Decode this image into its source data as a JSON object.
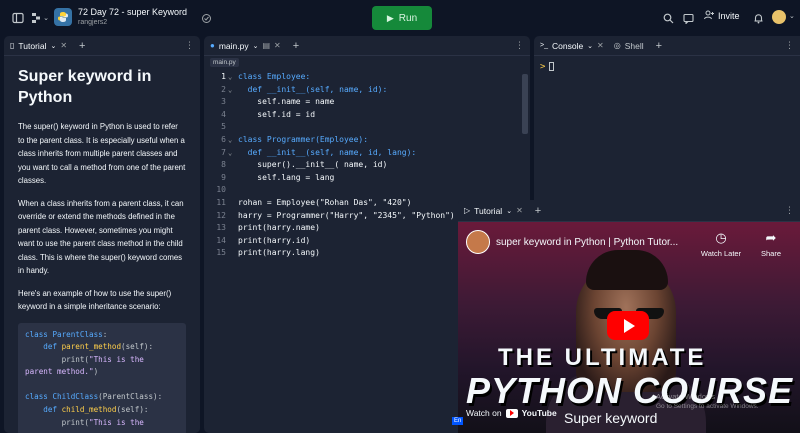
{
  "topbar": {
    "repl_title": "72 Day 72 - super Keyword",
    "repl_user": "rangjers2",
    "run_label": "Run",
    "invite_label": "Invite"
  },
  "tutorial_pane": {
    "tab_label": "Tutorial",
    "title": "Super keyword in Python",
    "paragraphs": [
      "The super() keyword in Python is used to refer to the parent class. It is especially useful when a class inherits from multiple parent classes and you want to call a method from one of the parent classes.",
      "When a class inherits from a parent class, it can override or extend the methods defined in the parent class. However, sometimes you might want to use the parent class method in the child class. This is where the super() keyword comes in handy.",
      "Here's an example of how to use the super() keyword in a simple inheritance scenario:"
    ]
  },
  "editor": {
    "tab_label": "main.py",
    "crumb": "main.py",
    "lines": [
      {
        "n": "1",
        "t": "class Employee:"
      },
      {
        "n": "2",
        "t": "  def __init__(self, name, id):"
      },
      {
        "n": "3",
        "t": "    self.name = name"
      },
      {
        "n": "4",
        "t": "    self.id = id"
      },
      {
        "n": "5",
        "t": ""
      },
      {
        "n": "6",
        "t": "class Programmer(Employee):"
      },
      {
        "n": "7",
        "t": "  def __init__(self, name, id, lang):"
      },
      {
        "n": "8",
        "t": "    super().__init__( name, id)"
      },
      {
        "n": "9",
        "t": "    self.lang = lang"
      },
      {
        "n": "10",
        "t": ""
      },
      {
        "n": "11",
        "t": "rohan = Employee(\"Rohan Das\", \"420\")"
      },
      {
        "n": "12",
        "t": "harry = Programmer(\"Harry\", \"2345\", \"Python\")"
      },
      {
        "n": "13",
        "t": "print(harry.name)"
      },
      {
        "n": "14",
        "t": "print(harry.id)"
      },
      {
        "n": "15",
        "t": "print(harry.lang)"
      }
    ]
  },
  "console_pane": {
    "tab_console": "Console",
    "tab_shell": "Shell",
    "prompt": ">"
  },
  "video_pane": {
    "tab_label": "Tutorial",
    "video_title": "super keyword in Python | Python Tutor...",
    "watch_later": "Watch Later",
    "share": "Share",
    "headline_1": "THE ULTIMATE",
    "headline_2": "PYTHON COURSE",
    "watch_on": "Watch on",
    "youtube": "YouTube",
    "subtitle": "Super keyword",
    "activate_1": "Activate Windows",
    "activate_2": "Go to Settings to activate Windows."
  },
  "language_badge": "En",
  "colors": {
    "bg": "#0e1525",
    "pane": "#1c2333",
    "run": "#15893a",
    "keyword": "#57abff",
    "youtube_red": "#ff0000"
  }
}
